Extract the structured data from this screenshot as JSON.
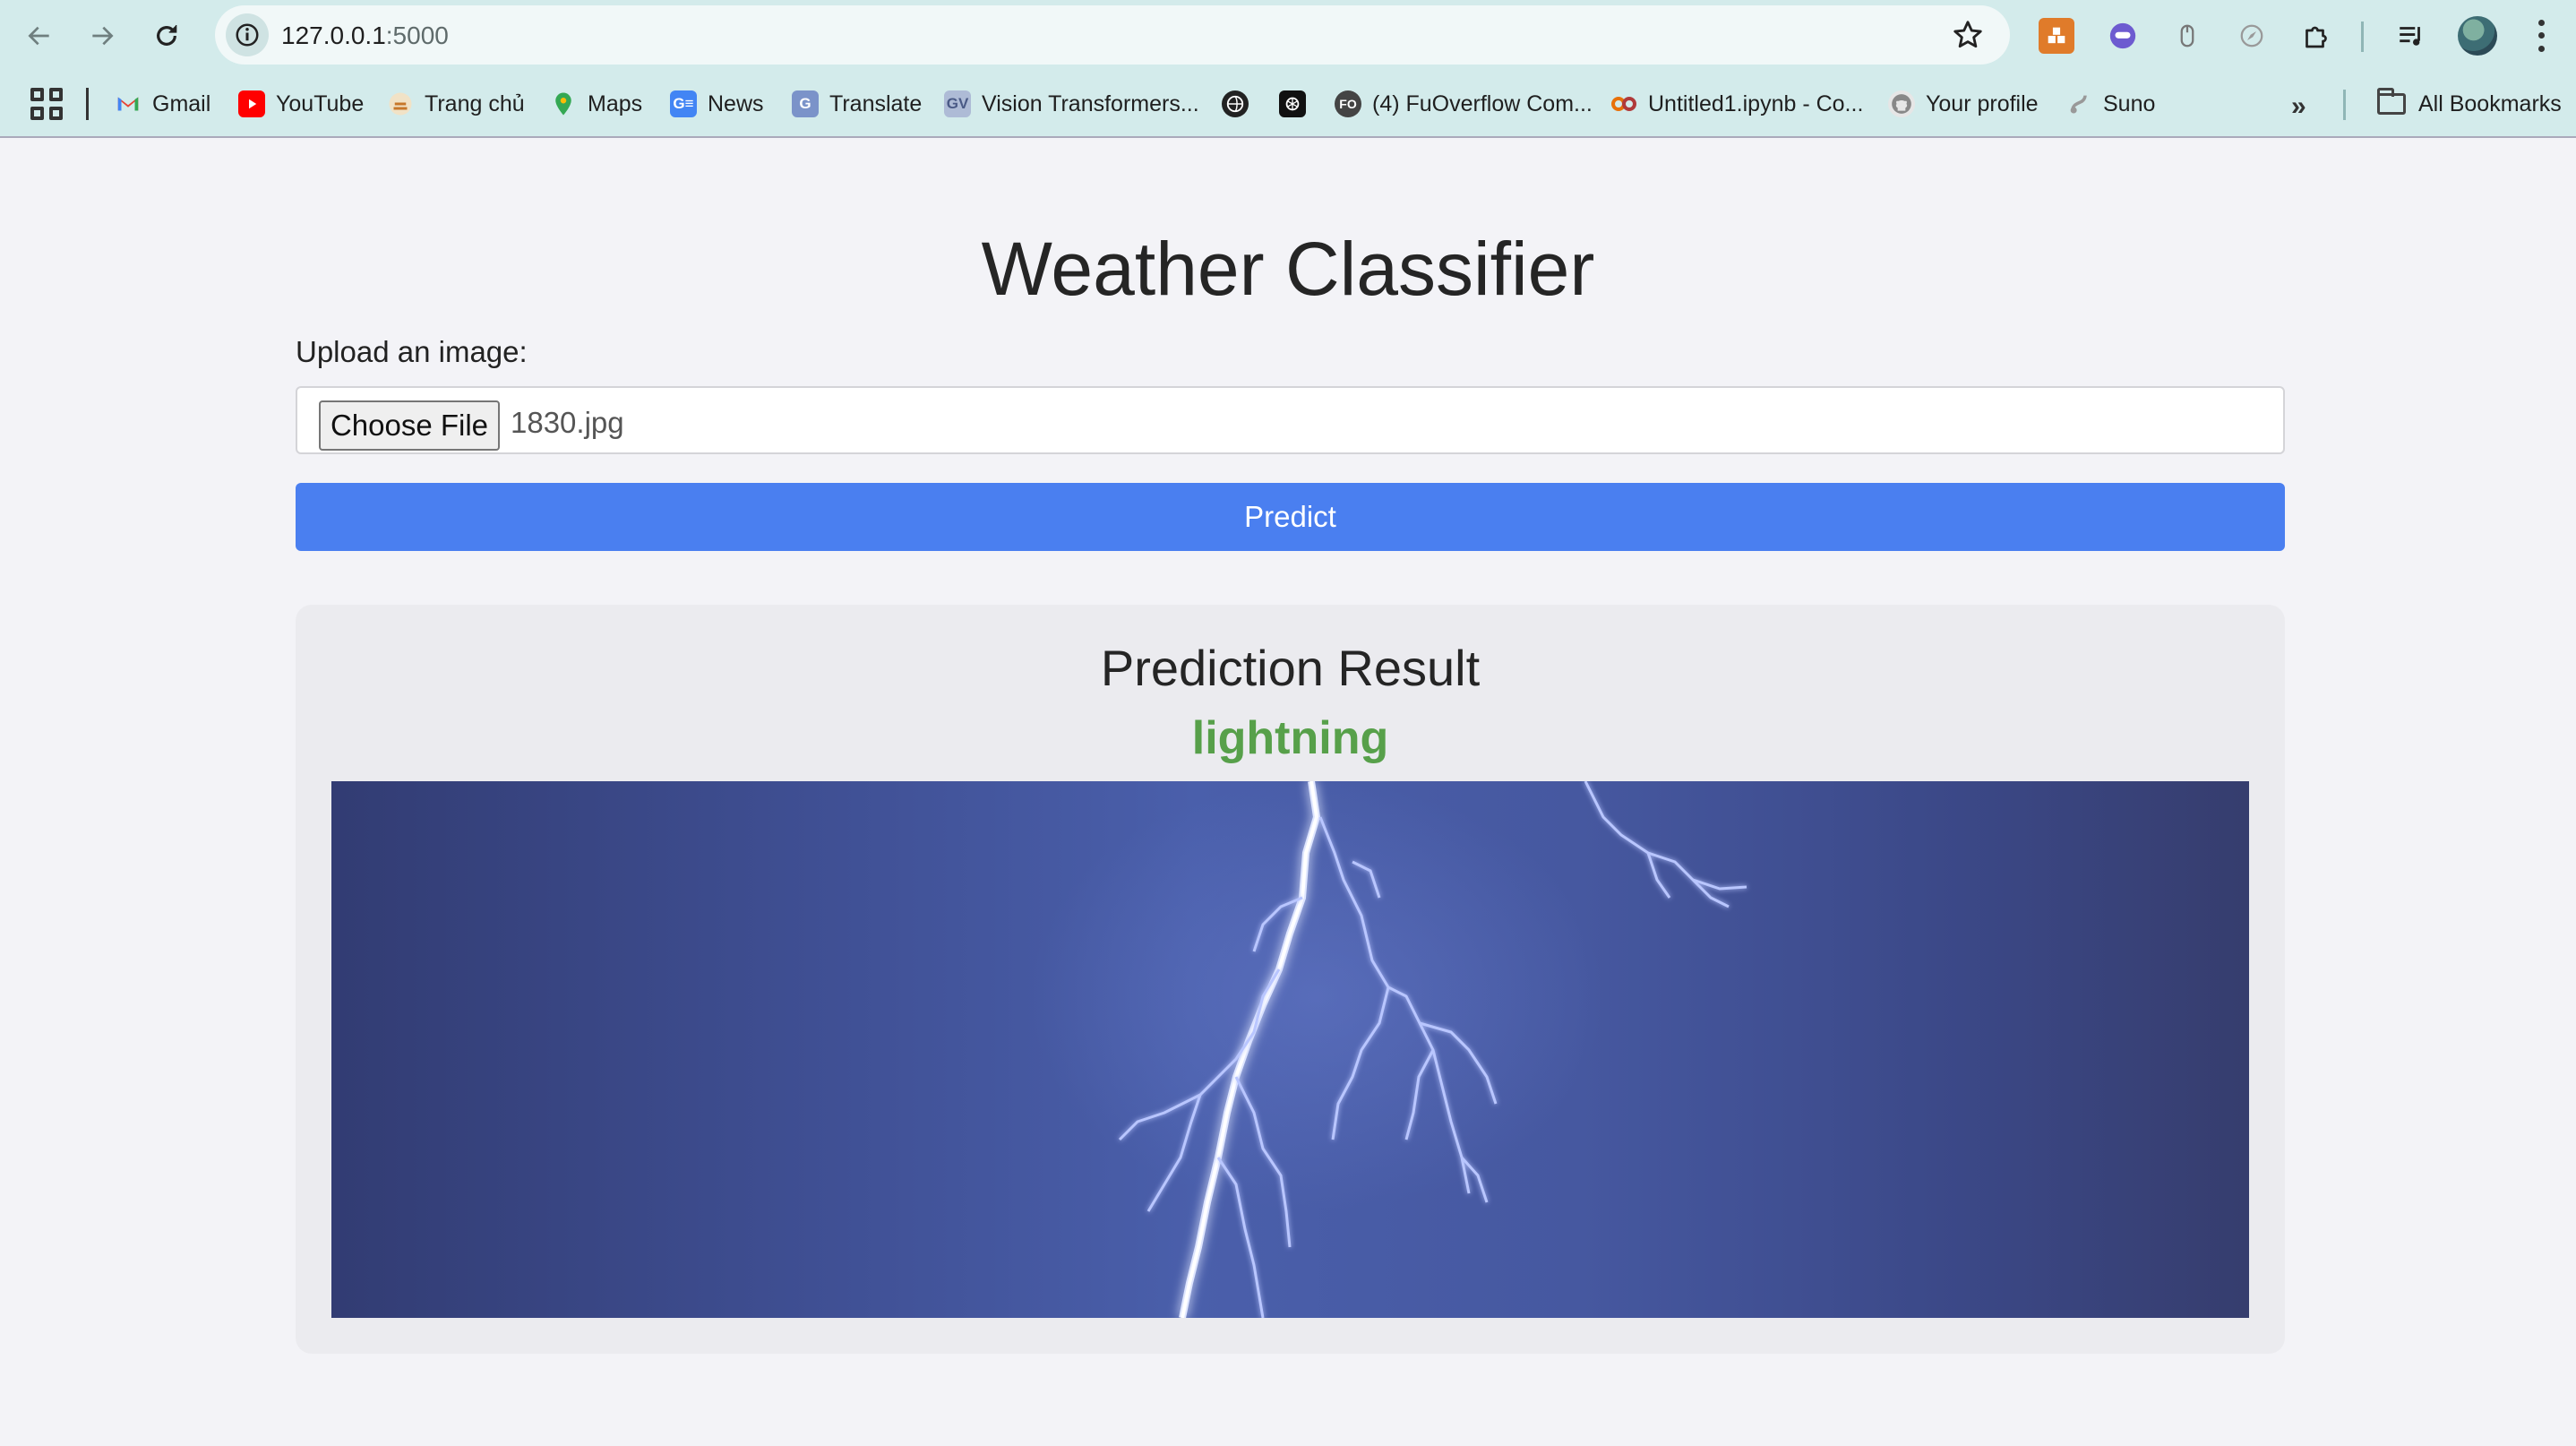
{
  "browser": {
    "url_host": "127.0.0.1",
    "url_port": ":5000",
    "nav_icons": [
      "back-icon",
      "forward-icon",
      "reload-icon"
    ],
    "extension_icons": [
      "extension-orange-icon",
      "extension-purple-icon",
      "extension-mouse-icon",
      "extension-compass-icon",
      "puzzle-icon"
    ]
  },
  "bookmarks": [
    {
      "label": "Gmail",
      "icon": "gmail-icon",
      "color": "#ea4335"
    },
    {
      "label": "YouTube",
      "icon": "youtube-icon",
      "color": "#ff0000"
    },
    {
      "label": "Trang chủ",
      "icon": "trang-chu-icon",
      "color": "#e8a33d"
    },
    {
      "label": "Maps",
      "icon": "maps-icon",
      "color": "#34a853"
    },
    {
      "label": "News",
      "icon": "news-icon",
      "color": "#4285f4"
    },
    {
      "label": "Translate",
      "icon": "translate-icon",
      "color": "#4285f4"
    },
    {
      "label": "Vision Transformers...",
      "icon": "vision-transformers-icon",
      "color": "#8aa0c8"
    },
    {
      "label": "",
      "icon": "globe-icon",
      "color": "#222222"
    },
    {
      "label": "",
      "icon": "openai-icon",
      "color": "#111111"
    },
    {
      "label": "(4) FuOverflow Com...",
      "icon": "fuoverflow-icon",
      "color": "#b03a3a"
    },
    {
      "label": "Untitled1.ipynb - Co...",
      "icon": "colab-icon",
      "color": "#e8710a"
    },
    {
      "label": "Your profile",
      "icon": "github-icon",
      "color": "#24292e"
    },
    {
      "label": "Suno",
      "icon": "suno-icon",
      "color": "#999999"
    }
  ],
  "bookmarks_more": "»",
  "all_bookmarks": "All Bookmarks",
  "page": {
    "title": "Weather Classifier",
    "upload_label": "Upload an image:",
    "choose_file_label": "Choose File",
    "file_name": "1830.jpg",
    "predict_label": "Predict",
    "result_title": "Prediction Result",
    "result_value": "lightning",
    "accent_color": "#4a7ff0",
    "result_color": "#57a04a"
  }
}
